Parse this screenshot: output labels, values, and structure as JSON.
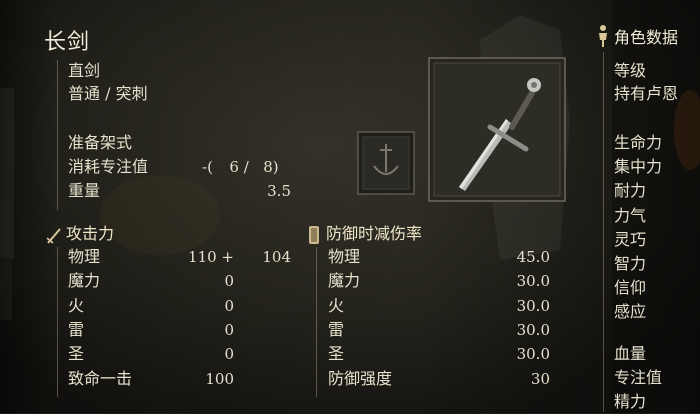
{
  "weapon": {
    "name": "长剑",
    "type": "直剑",
    "attack_type": "普通 / 突刺",
    "skill_label": "准备架式",
    "fp_cost_label": "消耗专注值",
    "fp_cost": {
      "prefix": "-(",
      "value1": "6",
      "slash": "/",
      "value2": "8",
      "suffix": ")"
    },
    "weight_label": "重量",
    "weight": "3.5"
  },
  "attack": {
    "header": "攻击力",
    "rows": [
      {
        "label": "物理",
        "value": "110 +",
        "extra": "104"
      },
      {
        "label": "魔力",
        "value": "0"
      },
      {
        "label": "火",
        "value": "0"
      },
      {
        "label": "雷",
        "value": "0"
      },
      {
        "label": "圣",
        "value": "0"
      },
      {
        "label": "致命一击",
        "value": "100"
      }
    ]
  },
  "guard": {
    "header": "防御时减伤率",
    "rows": [
      {
        "label": "物理",
        "value": "45.0"
      },
      {
        "label": "魔力",
        "value": "30.0"
      },
      {
        "label": "火",
        "value": "30.0"
      },
      {
        "label": "雷",
        "value": "30.0"
      },
      {
        "label": "圣",
        "value": "30.0"
      },
      {
        "label": "防御强度",
        "value": "30"
      }
    ]
  },
  "character": {
    "header": "角色数据",
    "level": "等级",
    "runes": "持有卢恩",
    "attributes": [
      "生命力",
      "集中力",
      "耐力",
      "力气",
      "灵巧",
      "智力",
      "信仰",
      "感应"
    ],
    "hp": "血量",
    "fp": "专注值",
    "stamina": "精力"
  },
  "icons": {
    "attack": "sword-attack-icon",
    "guard": "shield-guard-icon",
    "character": "character-figure-icon",
    "skill": "skill-emblem-icon",
    "weapon_image": "longsword-image"
  }
}
